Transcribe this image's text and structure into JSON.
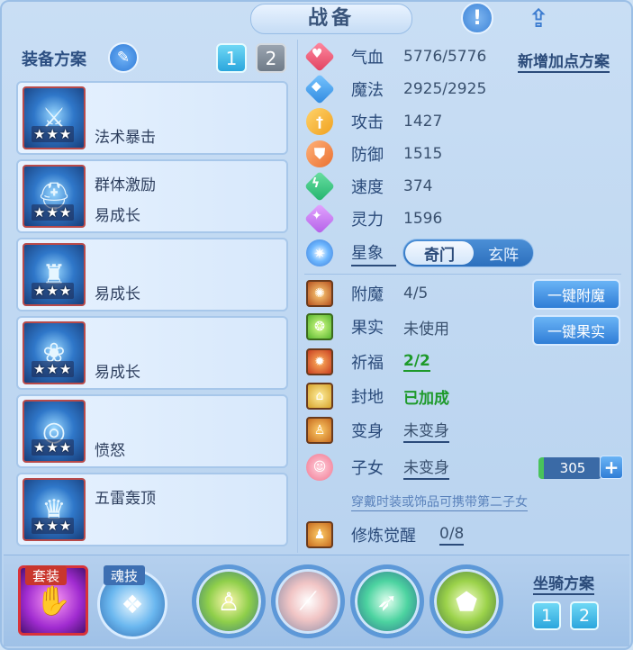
{
  "header": {
    "title": "战备",
    "info_icon": "exclamation-icon",
    "share_icon": "share-icon"
  },
  "equip_scheme": {
    "label": "装备方案",
    "tabs": [
      "1",
      "2"
    ],
    "active_tab": "1",
    "items": [
      {
        "stars": "★★★",
        "lines": [
          "",
          "法术暴击"
        ]
      },
      {
        "stars": "★★★",
        "lines": [
          "群体激励",
          "易成长"
        ]
      },
      {
        "stars": "★★★",
        "lines": [
          "",
          "易成长"
        ]
      },
      {
        "stars": "★★★",
        "lines": [
          "",
          "易成长"
        ]
      },
      {
        "stars": "★★★",
        "lines": [
          "",
          "愤怒"
        ]
      },
      {
        "stars": "★★★",
        "lines": [
          "五雷轰顶",
          ""
        ]
      }
    ]
  },
  "stats": {
    "add_plan": "新增加点方案",
    "rows": [
      {
        "label": "气血",
        "value": "5776/5776",
        "icon": "heart-icon"
      },
      {
        "label": "魔法",
        "value": "2925/2925",
        "icon": "mana-icon"
      },
      {
        "label": "攻击",
        "value": "1427",
        "icon": "attack-icon"
      },
      {
        "label": "防御",
        "value": "1515",
        "icon": "defense-icon"
      },
      {
        "label": "速度",
        "value": "374",
        "icon": "speed-icon"
      },
      {
        "label": "灵力",
        "value": "1596",
        "icon": "spirit-icon"
      }
    ],
    "star": {
      "label": "星象",
      "options": [
        "奇门",
        "玄阵"
      ],
      "selected": "奇门"
    }
  },
  "extras": {
    "enchant": {
      "label": "附魔",
      "value": "4/5",
      "button": "一键附魔"
    },
    "fruit": {
      "label": "果实",
      "value": "未使用",
      "button": "一键果实"
    },
    "blessing": {
      "label": "祈福",
      "value": "2/2"
    },
    "fief": {
      "label": "封地",
      "value": "已加成"
    },
    "transform": {
      "label": "变身",
      "value": "未变身"
    },
    "child": {
      "label": "子女",
      "value": "未变身",
      "bar_value": "305"
    },
    "hint": "穿戴时装或饰品可携带第二子女",
    "cultivation": {
      "label": "修炼觉醒",
      "value": "0/8"
    }
  },
  "bottom": {
    "set_label": "套装",
    "soul_label": "魂技",
    "mount_label": "坐骑方案",
    "mount_tabs": [
      "1",
      "2"
    ]
  },
  "colors": {
    "accent": "#2f7dd6",
    "green": "#1e9a2b",
    "panel": "#c9def4"
  }
}
